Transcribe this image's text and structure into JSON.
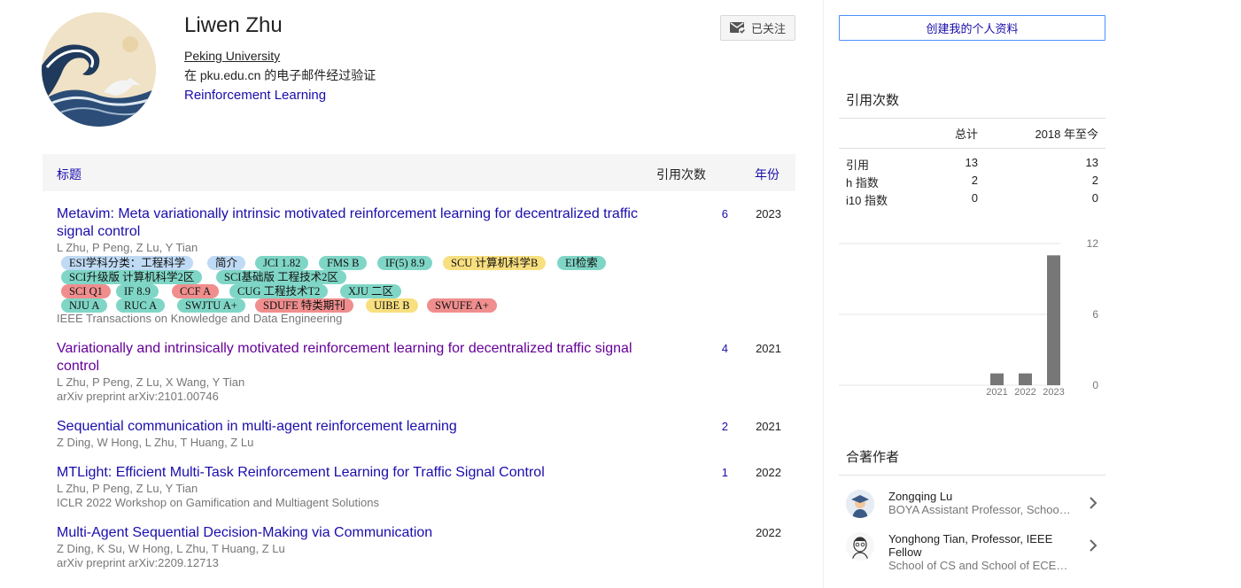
{
  "profile": {
    "name": "Liwen Zhu",
    "affiliation": "Peking University",
    "verified_email": "在 pku.edu.cn 的电子邮件经过验证",
    "interest": "Reinforcement Learning",
    "avatar_icon": "great-wave-avatar",
    "follow_label": "已关注",
    "follow_icon": "mail-check-icon"
  },
  "table": {
    "header_title": "标题",
    "header_cites": "引用次数",
    "header_year": "年份"
  },
  "publications": [
    {
      "title": "Metavim: Meta variationally intrinsic motivated reinforcement learning for decentralized traffic signal control",
      "authors": "L Zhu, P Peng, Z Lu, Y Tian",
      "venue": "IEEE Transactions on Knowledge and Data Engineering",
      "cites": "6",
      "year": "2023",
      "tags": [
        {
          "label": "ESI学科分类：工程科学",
          "color": "blue"
        },
        {
          "label": "简介",
          "color": "blue"
        },
        {
          "label": "JCI 1.82",
          "color": "teal"
        },
        {
          "label": "FMS B",
          "color": "teal"
        },
        {
          "label": "IF(5) 8.9",
          "color": "teal"
        },
        {
          "label": "SCU 计算机科学B",
          "color": "yellow"
        },
        {
          "label": "EI检索",
          "color": "teal"
        },
        {
          "label": "SCI升级版 计算机科学2区",
          "color": "teal"
        },
        {
          "label": "SCI基础版 工程技术2区",
          "color": "teal"
        },
        {
          "label": "SCI Q1",
          "color": "red"
        },
        {
          "label": "IF 8.9",
          "color": "teal"
        },
        {
          "label": "CCF A",
          "color": "red"
        },
        {
          "label": "CUG 工程技术T2",
          "color": "teal"
        },
        {
          "label": "XJU 二区",
          "color": "teal"
        },
        {
          "label": "NJU A",
          "color": "teal"
        },
        {
          "label": "RUC A",
          "color": "teal"
        },
        {
          "label": "SWJTU A+",
          "color": "teal"
        },
        {
          "label": "SDUFE 特类期刊",
          "color": "red"
        },
        {
          "label": "UIBE B",
          "color": "yellow"
        },
        {
          "label": "SWUFE A+",
          "color": "red"
        }
      ]
    },
    {
      "title": "Variationally and intrinsically motivated reinforcement learning for decentralized traffic signal control",
      "authors": "L Zhu, P Peng, Z Lu, X Wang, Y Tian",
      "venue": "arXiv preprint arXiv:2101.00746",
      "cites": "4",
      "year": "2021"
    },
    {
      "title": "Sequential communication in multi-agent reinforcement learning",
      "authors": "Z Ding, W Hong, L Zhu, T Huang, Z Lu",
      "venue": "",
      "cites": "2",
      "year": "2021"
    },
    {
      "title": "MTLight: Efficient Multi-Task Reinforcement Learning for Traffic Signal Control",
      "authors": "L Zhu, P Peng, Z Lu, Y Tian",
      "venue": "ICLR 2022 Workshop on Gamification and Multiagent Solutions",
      "cites": "1",
      "year": "2022"
    },
    {
      "title": "Multi-Agent Sequential Decision-Making via Communication",
      "authors": "Z Ding, K Su, W Hong, L Zhu, T Huang, Z Lu",
      "venue": "arXiv preprint arXiv:2209.12713",
      "cites": "",
      "year": "2022"
    }
  ],
  "sidebar": {
    "create_profile_label": "创建我的个人资料",
    "citations_title": "引用次数",
    "stats_header": [
      "",
      "总计",
      "2018 年至今"
    ],
    "stats_rows": [
      [
        "引用",
        "13",
        "13"
      ],
      [
        "h 指数",
        "2",
        "2"
      ],
      [
        "i10 指数",
        "0",
        "0"
      ]
    ],
    "coauthors_title": "合著作者",
    "coauthors": [
      {
        "name": "Zongqing Lu",
        "affiliation": "BOYA Assistant Professor, Schoo…",
        "avatar_icon": "graduate-avatar-icon",
        "chevron": "chevron-right-icon"
      },
      {
        "name": "Yonghong Tian, Professor, IEEE Fellow",
        "affiliation": "School of CS and School of ECE…",
        "avatar_icon": "sketch-portrait-icon",
        "chevron": "chevron-right-icon"
      }
    ]
  },
  "chart_data": {
    "type": "bar",
    "categories": [
      "2021",
      "2022",
      "2023"
    ],
    "values": [
      1,
      1,
      11
    ],
    "ylim": [
      0,
      12
    ],
    "yticks": [
      "12",
      "6",
      "0"
    ],
    "grid": true,
    "bar_color": "#777777"
  }
}
